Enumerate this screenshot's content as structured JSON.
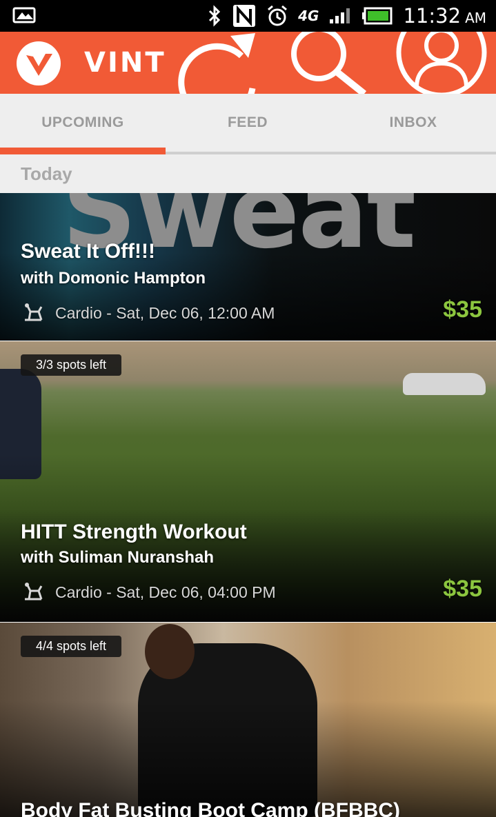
{
  "status_bar": {
    "time": "11:32",
    "ampm": "AM",
    "network": "4G",
    "icons": [
      "gallery-icon",
      "bluetooth-icon",
      "nfc-icon",
      "alarm-icon",
      "network-4g-icon",
      "signal-icon",
      "battery-icon"
    ]
  },
  "app_bar": {
    "title": "VINT",
    "brand_color": "#f15a36",
    "actions": [
      "refresh-icon",
      "search-icon",
      "profile-icon"
    ]
  },
  "tabs": [
    {
      "label": "UPCOMING",
      "selected": true
    },
    {
      "label": "FEED",
      "selected": false
    },
    {
      "label": "INBOX",
      "selected": false
    }
  ],
  "section": {
    "label": "Today"
  },
  "classes": [
    {
      "title": "Sweat It Off!!!",
      "instructor": "with Domonic Hampton",
      "category": "Cardio",
      "datetime": "Sat, Dec 06, 12:00 AM",
      "price": "$35",
      "banner_text": "Sweat"
    },
    {
      "spots": "3/3 spots left",
      "title": "HITT Strength Workout",
      "instructor": "with Suliman Nuranshah",
      "category": "Cardio",
      "datetime": "Sat, Dec 06, 04:00 PM",
      "price": "$35"
    },
    {
      "spots": "4/4 spots left",
      "title": "Body Fat Busting Boot Camp (BFBBC)"
    }
  ],
  "colors": {
    "accent": "#f15a36",
    "price": "#8cc63f",
    "tab_text": "#9a9a9a"
  }
}
